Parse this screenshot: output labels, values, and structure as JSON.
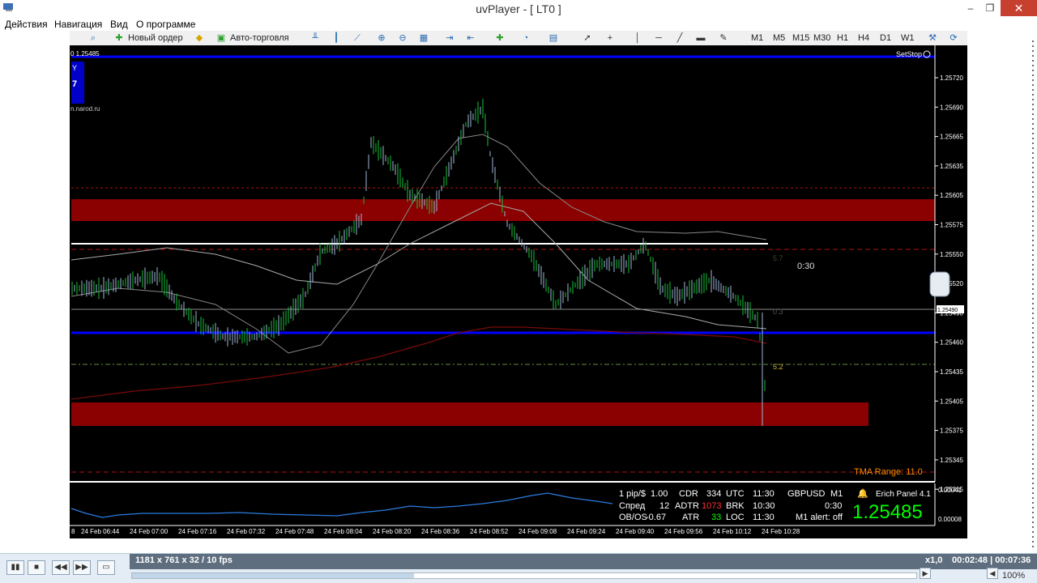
{
  "window": {
    "title": "uvPlayer - [ LT0 ]",
    "min": "–",
    "max": "❐",
    "close": "✕"
  },
  "menu": [
    "Действия",
    "Навигация",
    "Вид",
    "О программе"
  ],
  "toolbar": {
    "new_order": "Новый ордер",
    "auto_trading": "Авто-торговля",
    "timeframes": [
      "M1",
      "M5",
      "M15",
      "M30",
      "H1",
      "H4",
      "D1",
      "W1"
    ]
  },
  "chart": {
    "symbol_price": "0 1.25485",
    "badge_line1": "Y",
    "badge_line2": "7",
    "site": "n.narod.ru",
    "setstop": "SetStop",
    "price_ticks": [
      "1.25720",
      "1.25690",
      "1.25665",
      "1.25635",
      "1.25605",
      "1.25575",
      "1.25550",
      "1.25520",
      "1.25490",
      "1.25460",
      "1.25435",
      "1.25405",
      "1.25375",
      "1.25345",
      "1.25315"
    ],
    "current_price_marker": "1.25490",
    "bar_timer": "0:30",
    "level_label_upper": "5.7",
    "level_label_mid": "0.3",
    "level_label_lower": "5.2",
    "tma_range": "TMA Range: 11.0",
    "time_ticks": [
      "8",
      "24 Feb 06:44",
      "24 Feb 07:00",
      "24 Feb 07:16",
      "24 Feb 07:32",
      "24 Feb 07:48",
      "24 Feb 08:04",
      "24 Feb 08:20",
      "24 Feb 08:36",
      "24 Feb 08:52",
      "24 Feb 09:08",
      "24 Feb 09:24",
      "24 Feb 09:40",
      "24 Feb 09:56",
      "24 Feb 10:12",
      "24 Feb 10:28"
    ],
    "sub_ticks": [
      "0.00041",
      "0.00008"
    ]
  },
  "panel": {
    "row1": [
      "1 pip/$",
      "1.00",
      "CDR",
      "334",
      "UTC",
      "11:30",
      "GBPUSD",
      "M1"
    ],
    "row2": [
      "Спред",
      "12",
      "ADTR",
      "1073",
      "BRK",
      "10:30",
      "0:30"
    ],
    "row3": [
      "OB/OS",
      "-0.67",
      "ATR",
      "33",
      "LOC",
      "11:30",
      "M1 alert: off"
    ],
    "title": "Erich Panel 4.1",
    "bid": "1.25485"
  },
  "footer": {
    "info": "1181 x 761 x 32 / 10 fps",
    "speed": "x1,0",
    "time": "00:02:48 | 00:07:36",
    "volume": "100%",
    "progress": 0.36
  },
  "colors": {
    "bull": "#16c23a",
    "bear": "#9fb9d6",
    "zone": "#8b0000",
    "level_blue": "#0000ff",
    "bid_green": "#00ff00"
  }
}
